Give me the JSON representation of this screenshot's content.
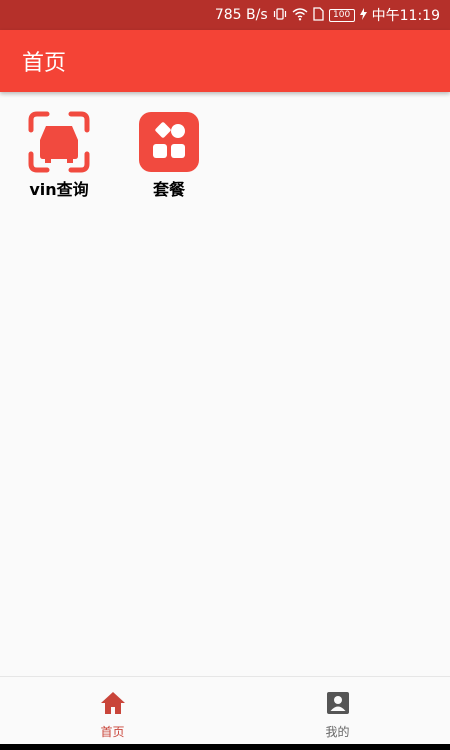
{
  "status_bar": {
    "speed": "785 B/s",
    "battery": "100",
    "time": "中午11:19"
  },
  "app_bar": {
    "title": "首页"
  },
  "grid": {
    "items": [
      {
        "label": "vin查询",
        "icon": "car-scan-icon"
      },
      {
        "label": "套餐",
        "icon": "apps-grid-icon"
      }
    ]
  },
  "bottom_nav": {
    "items": [
      {
        "label": "首页",
        "icon": "home-icon",
        "active": true
      },
      {
        "label": "我的",
        "icon": "account-box-icon",
        "active": false
      }
    ]
  },
  "colors": {
    "status_bar": "#b5302a",
    "app_bar": "#f44336",
    "icon_red": "#f14a3f",
    "active_tab": "#c9453a",
    "inactive_tab": "#555555"
  }
}
